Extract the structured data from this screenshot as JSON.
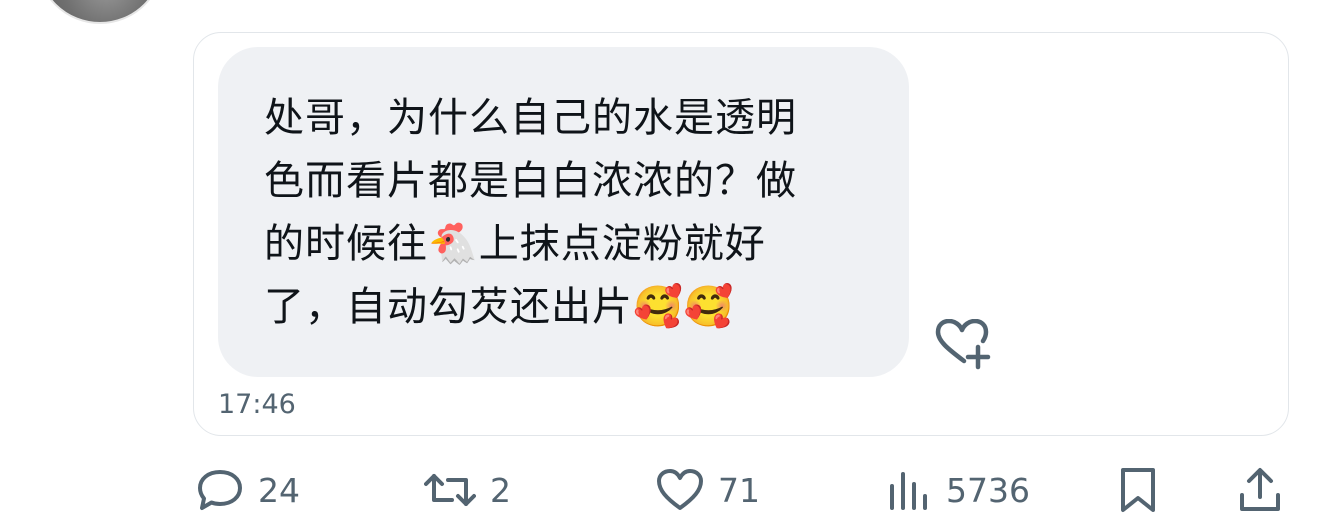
{
  "message": {
    "text": "处哥，为什么自己的水是透明\n色而看片都是白白浓浓的？做\n的时候往🐔上抹点淀粉就好\n了，自动勾芡还出片🥰🥰",
    "time": "17:46"
  },
  "actions": {
    "reply_count": "24",
    "retweet_count": "2",
    "like_count": "71",
    "view_count": "5736"
  },
  "icons": {
    "reply": "speech-bubble-icon",
    "retweet": "retweet-arrows-icon",
    "like": "heart-icon",
    "views": "bar-chart-icon",
    "bookmark": "bookmark-icon",
    "share": "share-upload-icon",
    "react": "heart-plus-icon"
  },
  "colors": {
    "text": "#0f1419",
    "muted": "#536471",
    "bubble": "#eff1f4",
    "border": "#e2e6ea"
  }
}
